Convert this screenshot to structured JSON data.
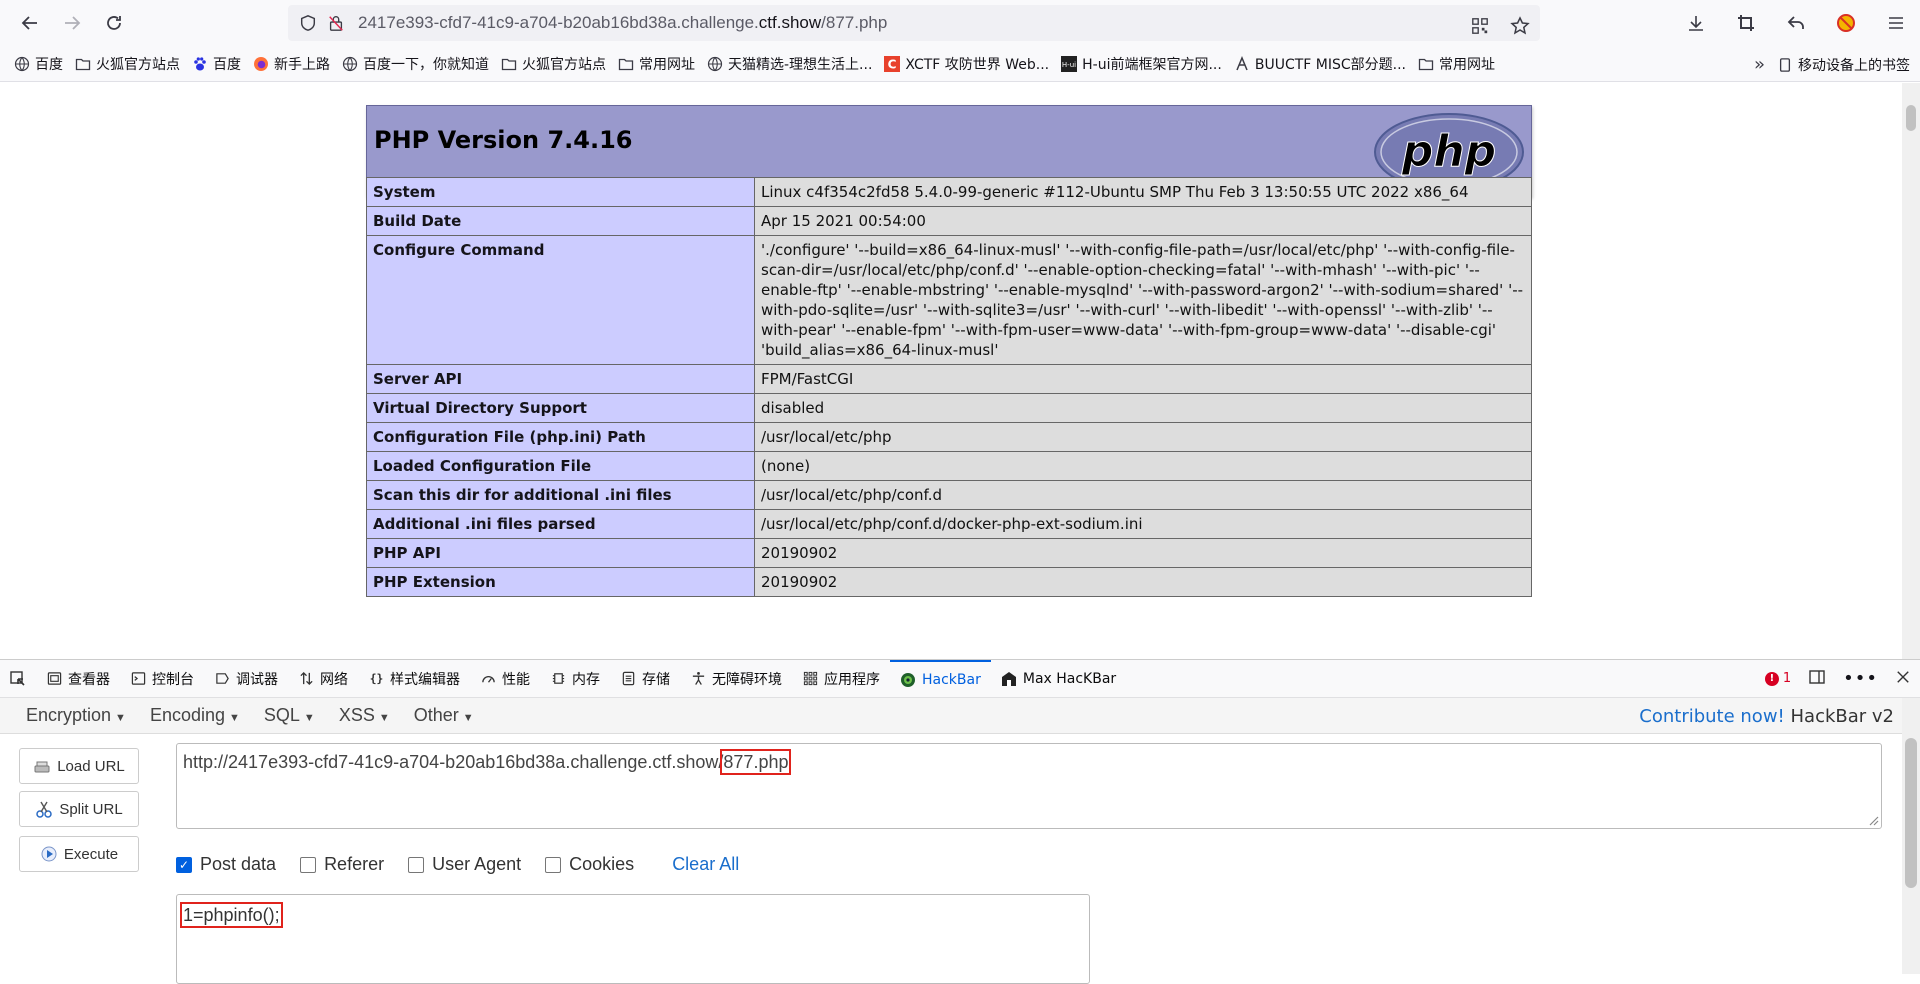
{
  "browser": {
    "url_prefix": "2417e393-cfd7-41c9-a704-b20ab16bd38a.challenge.",
    "url_host": "ctf.show",
    "url_path": "/877.php"
  },
  "bookmarks": [
    {
      "icon": "globe-icon",
      "label": "百度"
    },
    {
      "icon": "folder-icon",
      "label": "火狐官方站点"
    },
    {
      "icon": "baidu-paw-icon",
      "label": "百度"
    },
    {
      "icon": "firefox-icon",
      "label": "新手上路"
    },
    {
      "icon": "globe-icon",
      "label": "百度一下，你就知道"
    },
    {
      "icon": "folder-icon",
      "label": "火狐官方站点"
    },
    {
      "icon": "folder-icon",
      "label": "常用网址"
    },
    {
      "icon": "globe-icon",
      "label": "天猫精选-理想生活上..."
    },
    {
      "icon": "xctf-icon",
      "label": "XCTF 攻防世界 Web..."
    },
    {
      "icon": "hui-icon",
      "label": "H-ui前端框架官方网..."
    },
    {
      "icon": "buuctf-icon",
      "label": "BUUCTF MISC部分题..."
    },
    {
      "icon": "folder-icon",
      "label": "常用网址"
    }
  ],
  "mobile_bookmarks": "移动设备上的书签",
  "phpinfo": {
    "title": "PHP Version 7.4.16",
    "logo_text": "php",
    "rows": [
      {
        "k": "System",
        "v": "Linux c4f354c2fd58 5.4.0-99-generic #112-Ubuntu SMP Thu Feb 3 13:50:55 UTC 2022 x86_64"
      },
      {
        "k": "Build Date",
        "v": "Apr 15 2021 00:54:00"
      },
      {
        "k": "Configure Command",
        "v": "'./configure' '--build=x86_64-linux-musl' '--with-config-file-path=/usr/local/etc/php' '--with-config-file-scan-dir=/usr/local/etc/php/conf.d' '--enable-option-checking=fatal' '--with-mhash' '--with-pic' '--enable-ftp' '--enable-mbstring' '--enable-mysqlnd' '--with-password-argon2' '--with-sodium=shared' '--with-pdo-sqlite=/usr' '--with-sqlite3=/usr' '--with-curl' '--with-libedit' '--with-openssl' '--with-zlib' '--with-pear' '--enable-fpm' '--with-fpm-user=www-data' '--with-fpm-group=www-data' '--disable-cgi' 'build_alias=x86_64-linux-musl'"
      },
      {
        "k": "Server API",
        "v": "FPM/FastCGI"
      },
      {
        "k": "Virtual Directory Support",
        "v": "disabled"
      },
      {
        "k": "Configuration File (php.ini) Path",
        "v": "/usr/local/etc/php"
      },
      {
        "k": "Loaded Configuration File",
        "v": "(none)"
      },
      {
        "k": "Scan this dir for additional .ini files",
        "v": "/usr/local/etc/php/conf.d"
      },
      {
        "k": "Additional .ini files parsed",
        "v": "/usr/local/etc/php/conf.d/docker-php-ext-sodium.ini"
      },
      {
        "k": "PHP API",
        "v": "20190902"
      },
      {
        "k": "PHP Extension",
        "v": "20190902"
      }
    ]
  },
  "devtools": {
    "tabs": [
      {
        "icon": "inspector-icon",
        "label": "查看器"
      },
      {
        "icon": "console-icon",
        "label": "控制台"
      },
      {
        "icon": "debugger-icon",
        "label": "调试器"
      },
      {
        "icon": "network-icon",
        "label": "网络"
      },
      {
        "icon": "style-editor-icon",
        "label": "样式编辑器"
      },
      {
        "icon": "performance-icon",
        "label": "性能"
      },
      {
        "icon": "memory-icon",
        "label": "内存"
      },
      {
        "icon": "storage-icon",
        "label": "存储"
      },
      {
        "icon": "accessibility-icon",
        "label": "无障碍环境"
      },
      {
        "icon": "application-icon",
        "label": "应用程序"
      },
      {
        "icon": "hackbar-icon",
        "label": "HackBar"
      },
      {
        "icon": "max-hackbar-icon",
        "label": "Max HacKBar"
      }
    ],
    "error_count": "1"
  },
  "hackbar": {
    "menu": [
      "Encryption",
      "Encoding",
      "SQL",
      "XSS",
      "Other"
    ],
    "contribute": "Contribute now!",
    "version": "HackBar v2",
    "load_url": "Load URL",
    "split_url": "Split URL",
    "execute": "Execute",
    "url_prefix": "http://2417e393-cfd7-41c9-a704-b20ab16bd38a.challenge.ctf.show/",
    "url_file": "877.php",
    "options": [
      {
        "label": "Post data",
        "checked": true
      },
      {
        "label": "Referer",
        "checked": false
      },
      {
        "label": "User Agent",
        "checked": false
      },
      {
        "label": "Cookies",
        "checked": false
      }
    ],
    "clear_all": "Clear All",
    "post_body": "1=phpinfo();"
  }
}
